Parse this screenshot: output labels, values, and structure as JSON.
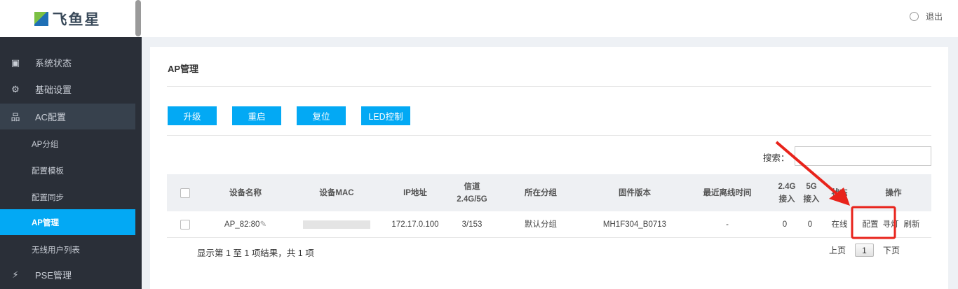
{
  "brand": "飞鱼星",
  "header": {
    "logout": "退出"
  },
  "sidebar": {
    "items": [
      {
        "label": "系统状态",
        "icon": "monitor-icon"
      },
      {
        "label": "基础设置",
        "icon": "gear-icon"
      },
      {
        "label": "AC配置",
        "icon": "network-icon"
      },
      {
        "label": "PSE管理",
        "icon": "bolt-icon"
      }
    ],
    "sub": [
      "AP分组",
      "配置模板",
      "配置同步",
      "AP管理",
      "无线用户列表"
    ]
  },
  "page": {
    "title": "AP管理",
    "buttons": [
      "升级",
      "重启",
      "复位",
      "LED控制"
    ],
    "search_label": "搜索：",
    "search_value": ""
  },
  "table": {
    "headers": [
      "设备名称",
      "设备MAC",
      "IP地址",
      "信道\n2.4G/5G",
      "所在分组",
      "固件版本",
      "最近离线时间",
      "2.4G\n接入",
      "5G\n接入",
      "状态",
      "操作"
    ],
    "rows": [
      {
        "name": "AP_82:80",
        "mac": "",
        "ip": "172.17.0.100",
        "channel": "3/153",
        "group": "默认分组",
        "firmware": "MH1F304_B0713",
        "offline": "-",
        "c24": "0",
        "c5": "0",
        "status": "在线",
        "actions": [
          "配置",
          "寻灯",
          "刷新"
        ]
      }
    ]
  },
  "footer": {
    "info": "显示第 1 至 1 项结果，共 1 项",
    "prev": "上页",
    "page": "1",
    "next": "下页"
  },
  "annotation_color": "#e8231b"
}
